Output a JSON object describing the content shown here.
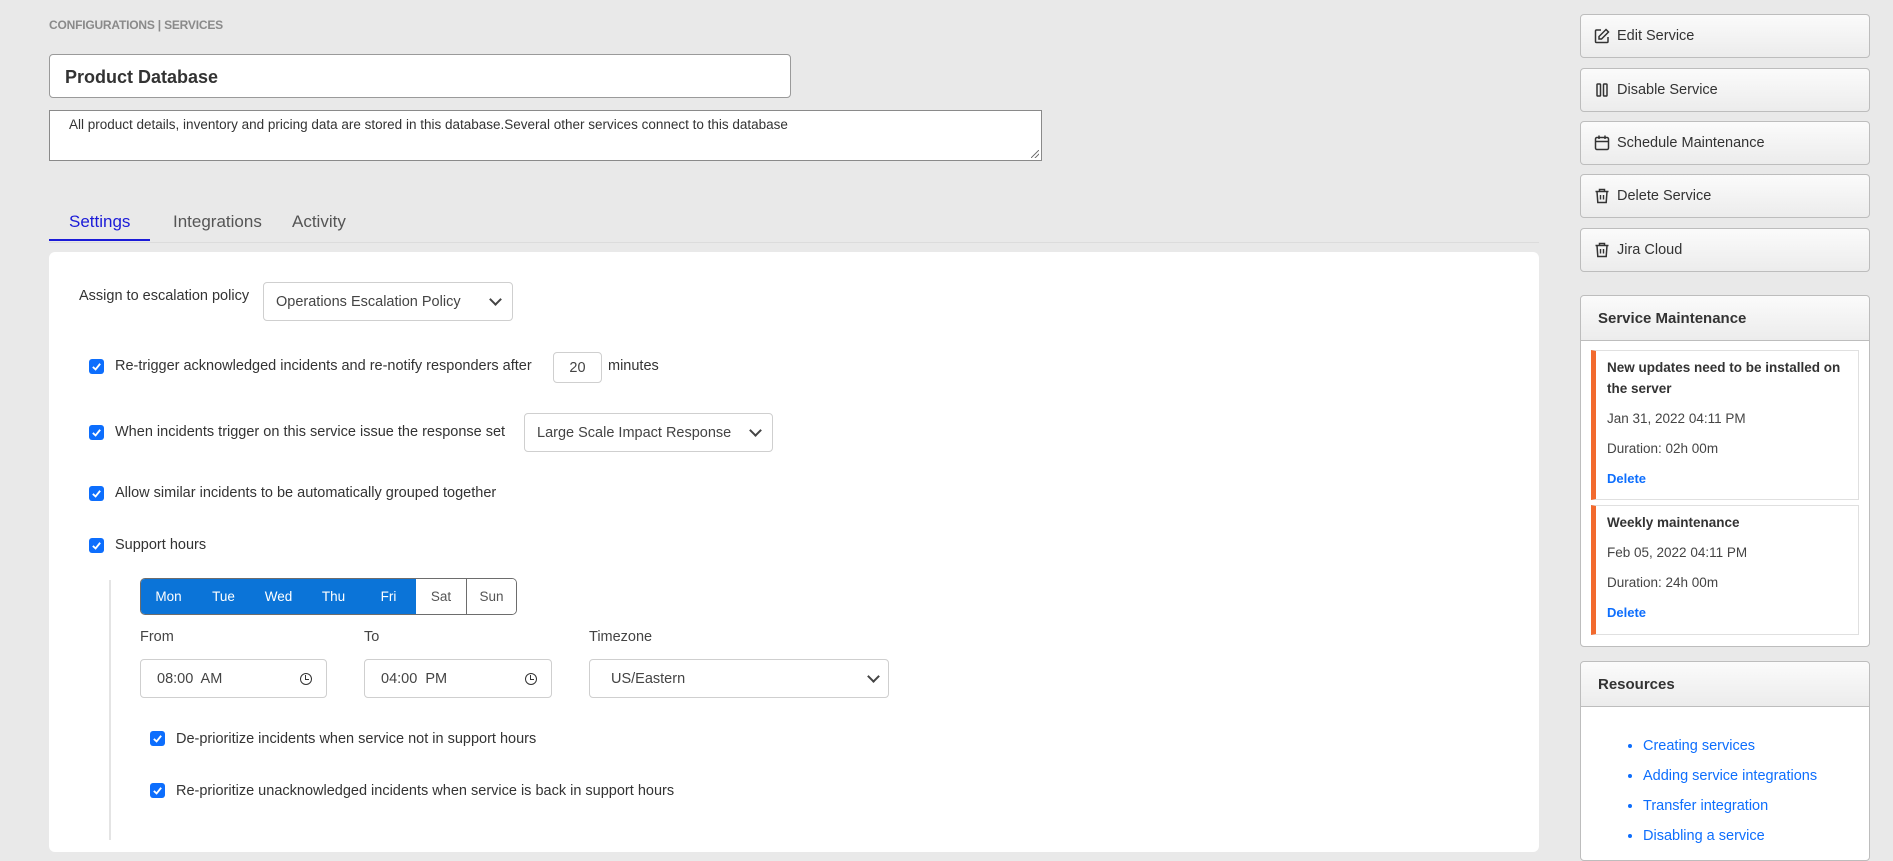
{
  "breadcrumb": "CONFIGURATIONS | SERVICES",
  "service": {
    "name": "Product Database",
    "description": "All product details, inventory and pricing data are stored in this database.Several other services connect to this database"
  },
  "tabs": [
    {
      "label": "Settings",
      "active": true
    },
    {
      "label": "Integrations",
      "active": false
    },
    {
      "label": "Activity",
      "active": false
    }
  ],
  "settings": {
    "escalation": {
      "label": "Assign to escalation policy",
      "selected": "Operations Escalation Policy"
    },
    "retrigger": {
      "checked": true,
      "label_before": "Re-trigger acknowledged incidents and re-notify responders after",
      "minutes": "20",
      "label_after": "minutes"
    },
    "response_set": {
      "checked": true,
      "label": "When incidents trigger on this service issue the response set",
      "selected": "Large Scale Impact Response"
    },
    "grouping": {
      "checked": true,
      "label": "Allow similar incidents to be automatically grouped together"
    },
    "support_hours": {
      "checked": true,
      "label": "Support hours",
      "days": [
        {
          "label": "Mon",
          "selected": true
        },
        {
          "label": "Tue",
          "selected": true
        },
        {
          "label": "Wed",
          "selected": true
        },
        {
          "label": "Thu",
          "selected": true
        },
        {
          "label": "Fri",
          "selected": true
        },
        {
          "label": "Sat",
          "selected": false
        },
        {
          "label": "Sun",
          "selected": false
        }
      ],
      "from_label": "From",
      "from_value": "08:00  AM",
      "to_label": "To",
      "to_value": "04:00  PM",
      "timezone_label": "Timezone",
      "timezone_value": "US/Eastern",
      "deprioritize": {
        "checked": true,
        "label": "De-prioritize incidents when service not in support hours"
      },
      "reprioritize": {
        "checked": true,
        "label": "Re-prioritize unacknowledged incidents when service is back in support hours"
      }
    }
  },
  "sidebar": {
    "actions": [
      {
        "label": "Edit Service",
        "icon": "edit-icon"
      },
      {
        "label": "Disable Service",
        "icon": "pause-icon"
      },
      {
        "label": "Schedule Maintenance",
        "icon": "calendar-icon"
      },
      {
        "label": "Delete Service",
        "icon": "trash-icon"
      },
      {
        "label": "Jira Cloud",
        "icon": "trash-icon"
      }
    ],
    "maintenance": {
      "title": "Service Maintenance",
      "items": [
        {
          "title": "New updates need to be installed on the server",
          "date": "Jan 31, 2022 04:11 PM",
          "duration": "Duration: 02h 00m",
          "delete_label": "Delete"
        },
        {
          "title": "Weekly maintenance",
          "date": "Feb 05, 2022 04:11 PM",
          "duration": "Duration: 24h 00m",
          "delete_label": "Delete"
        }
      ]
    },
    "resources": {
      "title": "Resources",
      "links": [
        "Creating services",
        "Adding service integrations",
        "Transfer integration",
        "Disabling a service"
      ]
    }
  },
  "colors": {
    "accent_blue": "#0b74d8",
    "checkbox_blue": "#0d6efd",
    "active_tab": "#1b1bd8",
    "maintenance_stripe": "#f26a2e"
  }
}
